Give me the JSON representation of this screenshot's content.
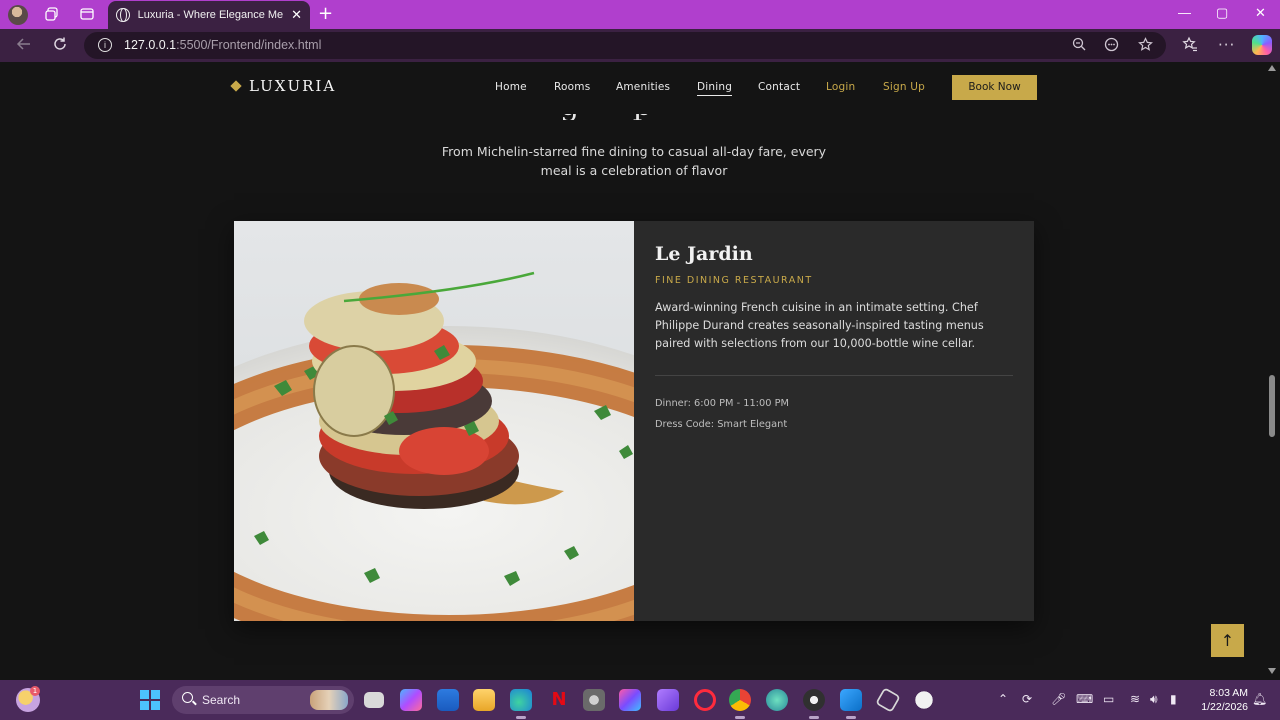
{
  "browser": {
    "tab_title": "Luxuria - Where Elegance Meets Luxury",
    "tab_close": "✕",
    "new_tab": "+",
    "url_host": "127.0.0.1",
    "url_rest": ":5500/Frontend/index.html",
    "window_controls": {
      "minimize": "—",
      "maximize": "▢",
      "close": "✕"
    },
    "accent_color": "#b03fcd"
  },
  "site": {
    "logo": "LUXURIA",
    "nav": {
      "home": "Home",
      "rooms": "Rooms",
      "amenities": "Amenities",
      "dining": "Dining",
      "contact": "Contact",
      "login": "Login",
      "signup": "Sign Up",
      "book": "Book Now"
    },
    "active_nav": "Dining",
    "gold_color": "#c8a94a",
    "intro": "From Michelin-starred fine dining to casual all-day fare, every meal is a celebration of flavor",
    "restaurant": {
      "name": "Le Jardin",
      "type": "FINE DINING RESTAURANT",
      "description": "Award-winning French cuisine in an intimate setting. Chef Philippe Durand creates seasonally-inspired tasting menus paired with selections from our 10,000-bottle wine cellar.",
      "hours": "Dinner: 6:00 PM - 11:00 PM",
      "dress_code": "Dress Code: Smart Elegant"
    },
    "back_to_top": "↑"
  },
  "taskbar": {
    "search_label": "Search",
    "weather_badge": "1",
    "time": "8:03 AM",
    "date": "1/22/2026"
  }
}
